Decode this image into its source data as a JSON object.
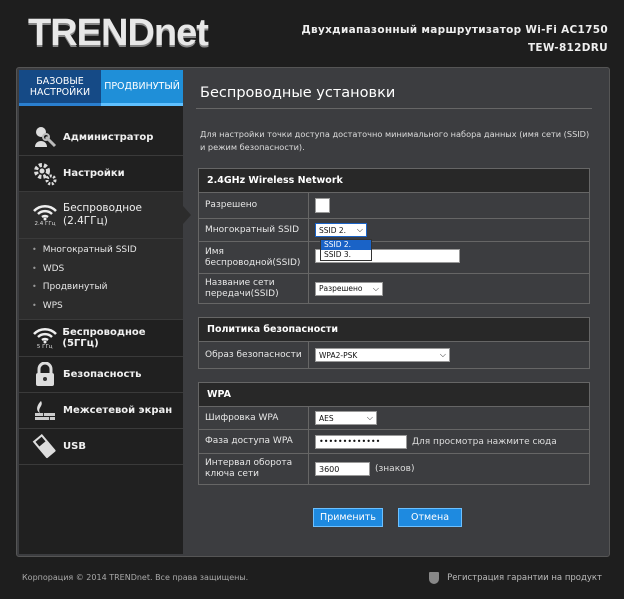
{
  "header": {
    "logo_part1": "TREND",
    "logo_part2": "net",
    "title_line1": "Двухдиапазонный маршрутизатор Wi-Fi AC1750",
    "title_line2": "TEW-812DRU"
  },
  "sidebar": {
    "mode_basic": "БАЗОВЫЕ НАСТРОЙКИ",
    "mode_advanced": "ПРОДВИНУТЫЙ",
    "items": [
      {
        "label": "Администратор",
        "icon": "admin-wrench-icon"
      },
      {
        "label": "Настройки",
        "icon": "gears-icon"
      },
      {
        "label": "Беспроводное (2.4ГГц)",
        "icon": "wifi-icon",
        "icon_caption": "2.4 ГГц"
      },
      {
        "label": "Беспроводное (5ГГц)",
        "icon": "wifi-icon",
        "icon_caption": "5 ГГц"
      },
      {
        "label": "Безопасность",
        "icon": "lock-icon"
      },
      {
        "label": "Межсетевой экран",
        "icon": "firewall-icon"
      },
      {
        "label": "USB",
        "icon": "usb-icon"
      }
    ],
    "sub_items": [
      "Многократный SSID",
      "WDS",
      "Продвинутый",
      "WPS"
    ]
  },
  "main": {
    "page_title": "Беспроводные установки",
    "intro": "Для настройки точки доступа достаточно минимального набора данных (имя сети (SSID) и режим безопасности).",
    "wireless": {
      "heading": "2.4GHz Wireless Network",
      "enabled_label": "Разрешено",
      "multi_ssid_label": "Многократный SSID",
      "multi_ssid_value": "SSID 2.",
      "multi_ssid_options": [
        "SSID 2.",
        "SSID 3."
      ],
      "ssid_label": "Имя беспроводной(SSID)",
      "ssid_value": "",
      "broadcast_label": "Название сети передачи(SSID)",
      "broadcast_value": "Разрешено"
    },
    "security": {
      "heading": "Политика безопасности",
      "mode_label": "Образ безопасности",
      "mode_value": "WPA2-PSK"
    },
    "wpa": {
      "heading": "WPA",
      "cipher_label": "Шифровка WPA",
      "cipher_value": "AES",
      "passphrase_label": "Фаза доступа WPA",
      "passphrase_value": "•••••••••••••",
      "passphrase_hint": "Для просмотра нажмите сюда",
      "rekey_label": "Интервал оборота ключа сети",
      "rekey_value": "3600",
      "rekey_unit": "(знаков)"
    },
    "apply_label": "Применить",
    "cancel_label": "Отмена"
  },
  "footer": {
    "copyright": "Корпорация © 2014 TRENDnet. Все права защищены.",
    "warranty": "Регистрация гарантии на продукт"
  },
  "colors": {
    "accent": "#1f8fd8",
    "button": "#1e8ae0",
    "highlight": "#1a63c7"
  }
}
